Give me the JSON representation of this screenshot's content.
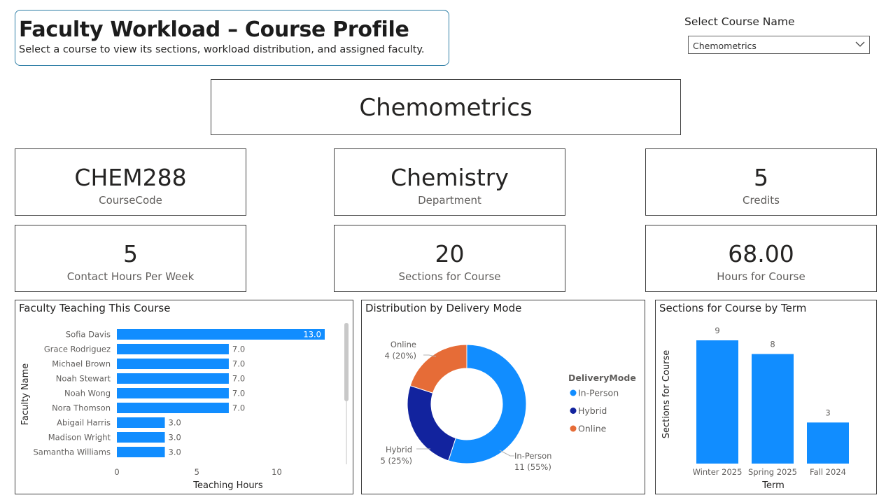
{
  "header": {
    "title": "Faculty Workload – Course Profile",
    "subtitle": "Select a course to view its sections, workload distribution, and assigned faculty."
  },
  "slicer": {
    "label": "Select Course Name",
    "selected": "Chemometrics",
    "icon": "chevron-down-icon"
  },
  "banner": {
    "course_name": "Chemometrics"
  },
  "kpis": {
    "course_code": {
      "value": "CHEM288",
      "label": "CourseCode"
    },
    "department": {
      "value": "Chemistry",
      "label": "Department"
    },
    "credits": {
      "value": "5",
      "label": "Credits"
    },
    "contact_hours": {
      "value": "5",
      "label": "Contact Hours Per Week"
    },
    "sections": {
      "value": "20",
      "label": "Sections for Course"
    },
    "hours": {
      "value": "68.00",
      "label": "Hours for Course"
    }
  },
  "colors": {
    "bar": "#118dff",
    "in_person": "#118dff",
    "hybrid": "#12239e",
    "online": "#e66c37"
  },
  "chart_data": [
    {
      "id": "faculty",
      "type": "bar",
      "orientation": "horizontal",
      "title": "Faculty Teaching This Course",
      "xlabel": "Teaching Hours",
      "ylabel": "Faculty Name",
      "categories": [
        "Sofia Davis",
        "Grace Rodriguez",
        "Michael Brown",
        "Noah Stewart",
        "Noah Wong",
        "Nora Thomson",
        "Abigail Harris",
        "Madison Wright",
        "Samantha Williams"
      ],
      "values": [
        13.0,
        7.0,
        7.0,
        7.0,
        7.0,
        7.0,
        3.0,
        3.0,
        3.0
      ],
      "data_labels": [
        "13.0",
        "7.0",
        "7.0",
        "7.0",
        "7.0",
        "7.0",
        "3.0",
        "3.0",
        "3.0"
      ],
      "xticks": [
        0,
        5,
        10
      ],
      "xlim": [
        0,
        13
      ]
    },
    {
      "id": "delivery",
      "type": "pie",
      "title": "Distribution by Delivery Mode",
      "legend_title": "DeliveryMode",
      "legend_position": "right",
      "slices": [
        {
          "name": "In-Person",
          "value": 11,
          "label": "11 (55%)"
        },
        {
          "name": "Hybrid",
          "value": 5,
          "label": "5 (25%)"
        },
        {
          "name": "Online",
          "value": 4,
          "label": "4 (20%)"
        }
      ]
    },
    {
      "id": "terms",
      "type": "bar",
      "title": "Sections for Course by Term",
      "xlabel": "Term",
      "ylabel": "Sections for Course",
      "categories": [
        "Winter 2025",
        "Spring 2025",
        "Fall 2024"
      ],
      "values": [
        9,
        8,
        3
      ],
      "ylim": [
        0,
        9
      ]
    }
  ]
}
